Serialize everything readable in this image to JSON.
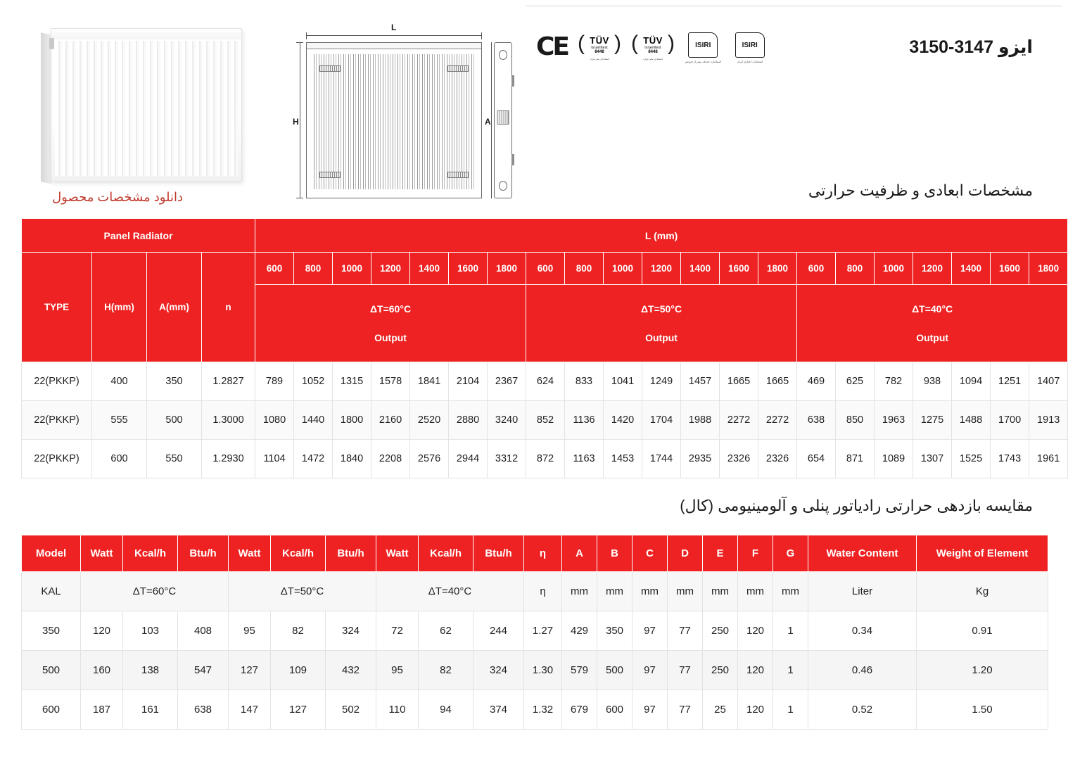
{
  "header": {
    "iso_title": "ایزو 3147-3150",
    "download_link": "دانلود مشخصات محصول",
    "drawing_labels": {
      "length": "L",
      "height": "H",
      "depth": "A"
    },
    "certifications": [
      {
        "name": "ce-mark",
        "label": "CE",
        "fine": ""
      },
      {
        "name": "tuv-mark-1",
        "label": "TÜV",
        "sub": "Israelitest",
        "sub2": "8448",
        "fine": "استاندارد ملی ایران"
      },
      {
        "name": "tuv-mark-2",
        "label": "TÜV",
        "sub": "Israelitest",
        "sub2": "8448",
        "fine": "استاندارد ملی ایران"
      },
      {
        "name": "isiri-mark-1",
        "label": "ISIRI",
        "fine": "استاندارد خدمات پس از فروش"
      },
      {
        "name": "isiri-mark-2",
        "label": "ISIRI",
        "fine": "استاندارد اجباری ایران"
      }
    ]
  },
  "sections": {
    "dimensions_heading": "مشخصات ابعادی و ظرفیت حرارتی",
    "comparison_heading": "مقایسه بازدهی حرارتی رادیاتور پنلی و آلومینیومی (کال)"
  },
  "table_dims": {
    "group_left": "Panel Radiator",
    "group_right": "L (mm)",
    "spec_headers": [
      "TYPE",
      "H(mm)",
      "A(mm)",
      "n"
    ],
    "lengths": [
      "600",
      "800",
      "1000",
      "1200",
      "1400",
      "1600",
      "1800"
    ],
    "delta_groups": [
      {
        "delta": "ΔT=60°C",
        "output": "Output"
      },
      {
        "delta": "ΔT=50°C",
        "output": "Output"
      },
      {
        "delta": "ΔT=40°C",
        "output": "Output"
      }
    ],
    "rows": [
      {
        "type": "22(PKKP)",
        "h": "400",
        "a": "350",
        "n": "1.2827",
        "dt60": [
          "789",
          "1052",
          "1315",
          "1578",
          "1841",
          "2104",
          "2367"
        ],
        "dt50": [
          "624",
          "833",
          "1041",
          "1249",
          "1457",
          "1665",
          "1665"
        ],
        "dt40": [
          "469",
          "625",
          "782",
          "938",
          "1094",
          "1251",
          "1407"
        ]
      },
      {
        "type": "22(PKKP)",
        "h": "555",
        "a": "500",
        "n": "1.3000",
        "dt60": [
          "1080",
          "1440",
          "1800",
          "2160",
          "2520",
          "2880",
          "3240"
        ],
        "dt50": [
          "852",
          "1136",
          "1420",
          "1704",
          "1988",
          "2272",
          "2272"
        ],
        "dt40": [
          "638",
          "850",
          "1963",
          "1275",
          "1488",
          "1700",
          "1913"
        ]
      },
      {
        "type": "22(PKKP)",
        "h": "600",
        "a": "550",
        "n": "1.2930",
        "dt60": [
          "1104",
          "1472",
          "1840",
          "2208",
          "2576",
          "2944",
          "3312"
        ],
        "dt50": [
          "872",
          "1163",
          "1453",
          "1744",
          "2935",
          "2326",
          "2326"
        ],
        "dt40": [
          "654",
          "871",
          "1089",
          "1307",
          "1525",
          "1743",
          "1961"
        ]
      }
    ]
  },
  "table_compare": {
    "headers": [
      "Model",
      "Watt",
      "Kcal/h",
      "Btu/h",
      "Watt",
      "Kcal/h",
      "Btu/h",
      "Watt",
      "Kcal/h",
      "Btu/h",
      "η",
      "A",
      "B",
      "C",
      "D",
      "E",
      "F",
      "G",
      "Water Content",
      "Weight of Element"
    ],
    "units": [
      "KAL",
      "ΔT=60°C",
      "ΔT=50°C",
      "ΔT=40°C",
      "η",
      "mm",
      "mm",
      "mm",
      "mm",
      "mm",
      "mm",
      "mm",
      "Liter",
      "Kg"
    ],
    "rows": [
      {
        "model": "350",
        "dt60": [
          "120",
          "103",
          "408"
        ],
        "dt50": [
          "95",
          "82",
          "324"
        ],
        "dt40": [
          "72",
          "62",
          "244"
        ],
        "eta": "1.27",
        "dims": [
          "429",
          "350",
          "97",
          "77",
          "250",
          "120",
          "1"
        ],
        "water": "0.34",
        "weight": "0.91"
      },
      {
        "model": "500",
        "dt60": [
          "160",
          "138",
          "547"
        ],
        "dt50": [
          "127",
          "109",
          "432"
        ],
        "dt40": [
          "95",
          "82",
          "324"
        ],
        "eta": "1.30",
        "dims": [
          "579",
          "500",
          "97",
          "77",
          "250",
          "120",
          "1"
        ],
        "water": "0.46",
        "weight": "1.20"
      },
      {
        "model": "600",
        "dt60": [
          "187",
          "161",
          "638"
        ],
        "dt50": [
          "147",
          "127",
          "502"
        ],
        "dt40": [
          "110",
          "94",
          "374"
        ],
        "eta": "1.32",
        "dims": [
          "679",
          "600",
          "97",
          "77",
          "25",
          "120",
          "1"
        ],
        "water": "0.52",
        "weight": "1.50"
      }
    ]
  },
  "colors": {
    "header_red": "#EE2222",
    "link_red": "#C0392B",
    "text_dark": "#222222",
    "stripe": "#F5F5F5"
  }
}
